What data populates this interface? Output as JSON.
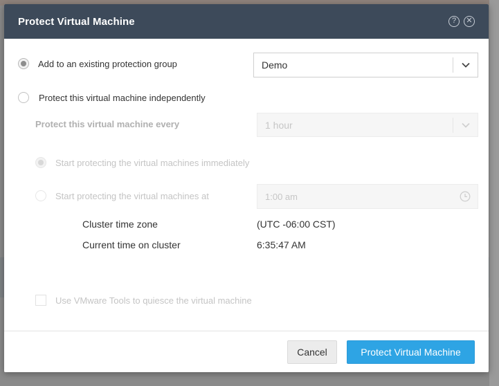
{
  "dialog": {
    "title": "Protect Virtual Machine",
    "help_icon": "help-circle-icon",
    "close_icon": "close-circle-icon"
  },
  "options": {
    "existing_group": {
      "label": "Add to an existing protection group",
      "selected": true,
      "group_value": "Demo"
    },
    "independent": {
      "label": "Protect this virtual machine independently",
      "selected": false
    }
  },
  "schedule": {
    "every_label": "Protect this virtual machine every",
    "every_value": "1 hour",
    "start_immediately_label": "Start protecting the virtual machines immediately",
    "start_at_label": "Start protecting the virtual machines at",
    "start_at_value": "1:00 am",
    "cluster_time_zone_label": "Cluster time zone",
    "cluster_time_zone_value": "(UTC -06:00 CST)",
    "current_time_label": "Current time on cluster",
    "current_time_value": "6:35:47 AM",
    "quiesce_label": "Use VMware Tools to quiesce the virtual machine"
  },
  "footer": {
    "cancel_label": "Cancel",
    "confirm_label": "Protect Virtual Machine"
  },
  "colors": {
    "header_bg": "#3d4a5a",
    "primary_button": "#2ea4e4"
  }
}
